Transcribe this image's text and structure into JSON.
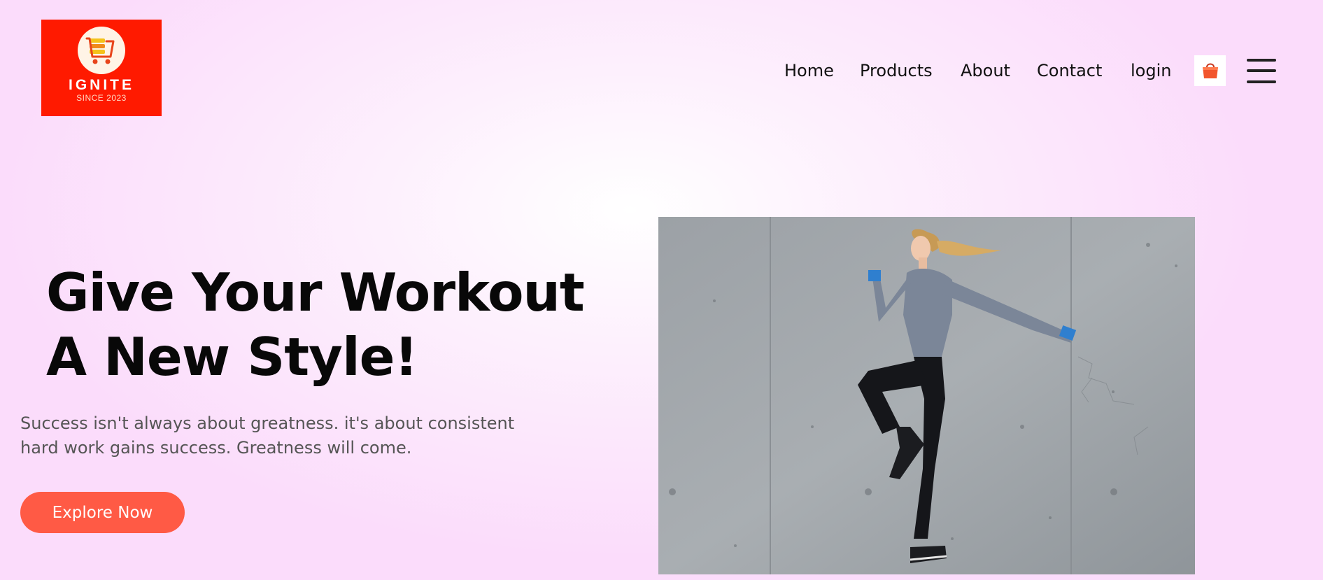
{
  "brand": {
    "name": "IGNITE",
    "tagline": "SINCE 2023",
    "logo_icon": "shopping-cart-icon",
    "logo_bg": "#ff1a00"
  },
  "nav": {
    "items": [
      {
        "label": "Home"
      },
      {
        "label": "Products"
      },
      {
        "label": "About"
      },
      {
        "label": "Contact"
      },
      {
        "label": "login"
      }
    ],
    "cart_icon": "shopping-bag-icon",
    "menu_icon": "hamburger-menu-icon"
  },
  "hero": {
    "title_line1": "Give Your Workout",
    "title_line2": "A New Style!",
    "text_line1": "Success isn't always about greatness. it's about consistent",
    "text_line2": "hard work gains success. Greatness will come.",
    "cta_label": "Explore Now",
    "accent_color": "#ff5a45",
    "image": "woman-running-against-concrete-wall-photo"
  }
}
